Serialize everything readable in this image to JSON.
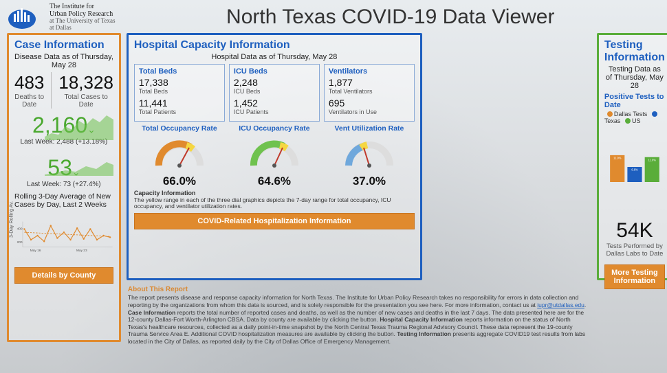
{
  "header": {
    "org_line1": "The Institute for",
    "org_line2": "Urban Policy Research",
    "org_line3": "at The University of Texas",
    "org_line4": "at Dallas",
    "title": "North Texas COVID-19 Data Viewer"
  },
  "case": {
    "heading": "Case Information",
    "subheading": "Disease Data as of Thursday, May 28",
    "deaths_value": "483",
    "deaths_label": "Deaths to Date",
    "cases_value": "18,328",
    "cases_label": "Total Cases to Date",
    "weekly_cases_value": "2,160",
    "weekly_cases_sub": "Last Week: 2,488 (+13.18%)",
    "weekly_deaths_value": "53",
    "weekly_deaths_sub": "Last Week: 73 (+27.4%)",
    "rolling_title": "Rolling 3-Day Average of New Cases by Day, Last 2 Weeks",
    "rolling_ylabel": "3-Day Rolling Av.",
    "button": "Details by County"
  },
  "hospital": {
    "heading": "Hospital Capacity Information",
    "subheading": "Hospital Data as of Thursday, May 28",
    "boxes": [
      {
        "title": "Total Beds",
        "n1": "17,338",
        "l1": "Total Beds",
        "n2": "11,441",
        "l2": "Total Patients"
      },
      {
        "title": "ICU Beds",
        "n1": "2,248",
        "l1": "ICU Beds",
        "n2": "1,452",
        "l2": "ICU Patients"
      },
      {
        "title": "Ventilators",
        "n1": "1,877",
        "l1": "Total Ventilators",
        "n2": "695",
        "l2": "Ventilators in Use"
      }
    ],
    "rates": [
      {
        "title": "Total Occupancy Rate",
        "pct": "66.0%"
      },
      {
        "title": "ICU Occupancy Rate",
        "pct": "64.6%"
      },
      {
        "title": "Vent Utilization Rate",
        "pct": "37.0%"
      }
    ],
    "cap_title": "Capacity Information",
    "cap_text": "The yellow range in each of the three dial graphics depicts the 7-day range for total occupancy, ICU occupancy, and ventilator utilization rates.",
    "button": "COVID-Related Hospitalization Information"
  },
  "testing": {
    "heading": "Testing Information",
    "subheading": "Testing Data as of Thursday, May 28",
    "bar_title": "Positive Tests to Date",
    "legend": [
      {
        "name": "Dallas Tests",
        "color": "#e08a2e"
      },
      {
        "name": "Texas",
        "color": "#1e5fbf"
      },
      {
        "name": "US",
        "color": "#5aad3a"
      }
    ],
    "tests_value": "54K",
    "tests_label": "Tests Performed by Dallas Labs to Date",
    "button": "More Testing Information"
  },
  "about": {
    "title": "About This Report",
    "p1a": "The report presents disease and response capacity information for North Texas. The Institute for Urban Policy Research takes no responsibility for errors in data collection and reporting by the organizations from whom this data is sourced, and is solely responsible for the presentation you see here. For more information, contact us at ",
    "email": "iupr@utdallas.edu",
    "p1b": ".",
    "p2_b": "Case Information",
    "p2": " reports the total number of reported cases and deaths, as well as the number of new cases and deaths in the last 7 days. The data presented here are for the 12-county Dallas-Fort Worth-Arlington CBSA. Data by county are available by clicking the button. ",
    "p3_b": "Hospital Capacity Information",
    "p3": " reports information on the status of North Texas's healthcare resources, collected as a daily point-in-time snapshot by the North Central Texas Trauma Regional Advisory Council. These data represent the 19-county Trauma Service Area E. Additional COVID hospitalization measures are available by clicking the button. ",
    "p4_b": "Testing Information",
    "p4": " presents aggregate COVID19 test results from labs located in the City of Dallas, as reported daily by the City of Dallas Office of Emergency Management."
  },
  "chart_data": [
    {
      "type": "line",
      "title": "Rolling 3-Day Average of New Cases by Day, Last 2 Weeks",
      "ylabel": "3-Day Rolling Av.",
      "x_ticks": [
        "May 16",
        "May 23"
      ],
      "ylim": [
        150,
        450
      ],
      "y_ticks": [
        200,
        400
      ],
      "series": [
        {
          "name": "3-day rolling avg",
          "color": "#e08a2e",
          "values": [
            370,
            250,
            300,
            230,
            420,
            280,
            340,
            250,
            380,
            260,
            370,
            250,
            300,
            280
          ]
        },
        {
          "name": "trend",
          "style": "dashed",
          "color": "#e08a2e",
          "values": [
            330,
            325,
            320,
            318,
            315,
            312,
            310,
            308,
            306,
            303,
            300,
            298,
            296,
            294
          ]
        }
      ]
    },
    {
      "type": "gauge",
      "title": "Total Occupancy Rate",
      "value": 66.0,
      "range": [
        0,
        100
      ],
      "yellow_band": [
        62,
        70
      ],
      "color": "#e08a2e"
    },
    {
      "type": "gauge",
      "title": "ICU Occupancy Rate",
      "value": 64.6,
      "range": [
        0,
        100
      ],
      "yellow_band": [
        60,
        69
      ],
      "color": "#5aad3a"
    },
    {
      "type": "gauge",
      "title": "Vent Utilization Rate",
      "value": 37.0,
      "range": [
        0,
        100
      ],
      "yellow_band": [
        34,
        41
      ],
      "color": "#6fa8dc"
    },
    {
      "type": "bar",
      "title": "Positive Tests to Date",
      "categories": [
        "Dallas Tests",
        "Texas",
        "US"
      ],
      "values": [
        11.9,
        6.8,
        11.0
      ],
      "value_labels": [
        "11.9%",
        "6.8%",
        "11.0%"
      ],
      "colors": [
        "#e08a2e",
        "#1e5fbf",
        "#5aad3a"
      ],
      "ylim": [
        0,
        13
      ]
    }
  ]
}
